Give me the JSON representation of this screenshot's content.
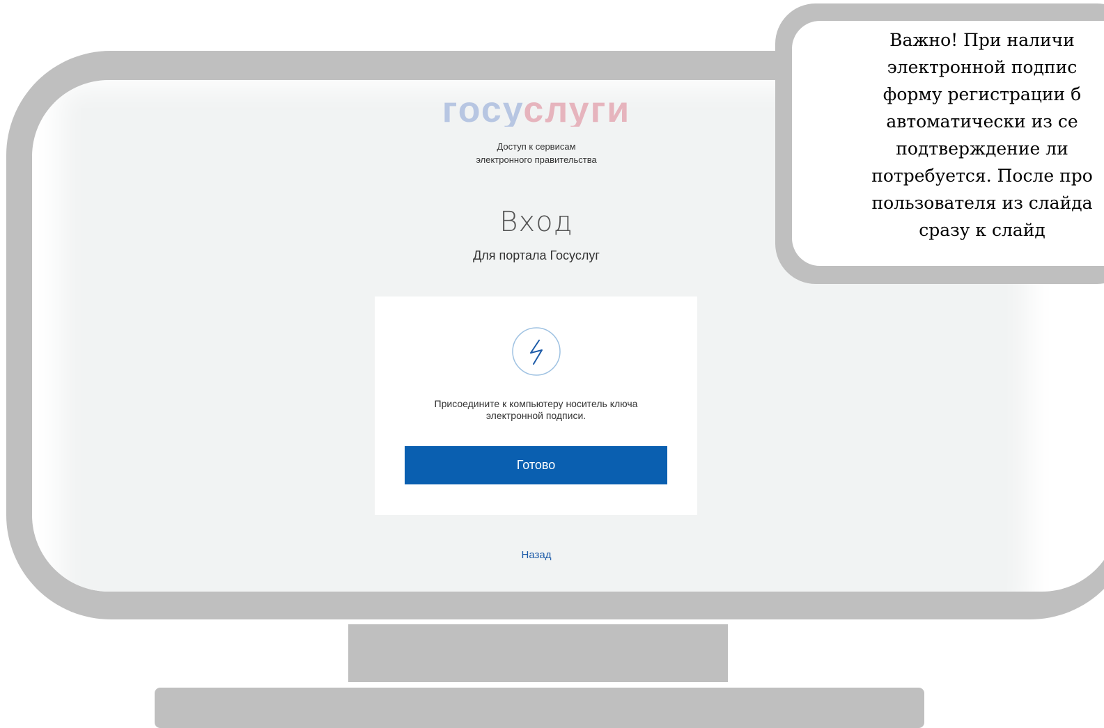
{
  "portal": {
    "logo_part1": "госу",
    "logo_part2": "слуги",
    "tagline_line1": "Доступ к сервисам",
    "tagline_line2": "электронного правительства",
    "title": "Вход",
    "subtitle": "Для портала Госуслуг"
  },
  "card": {
    "icon": "lightning-icon",
    "message_line1": "Присоедините к компьютеру носитель ключа",
    "message_line2": "электронной подписи.",
    "ready_button": "Готово"
  },
  "back_link": "Назад",
  "callout": {
    "lines": [
      "Важно! При наличи",
      "электронной подпис",
      "форму регистрации б",
      "автоматически из се",
      "подтверждение ли",
      "потребуется. После про",
      "пользователя из слайда",
      "сразу к слайд"
    ]
  },
  "colors": {
    "frame": "#bfbfbf",
    "screen_bg": "#f1f3f3",
    "button": "#0a5fb0",
    "link": "#1d5ba8"
  }
}
